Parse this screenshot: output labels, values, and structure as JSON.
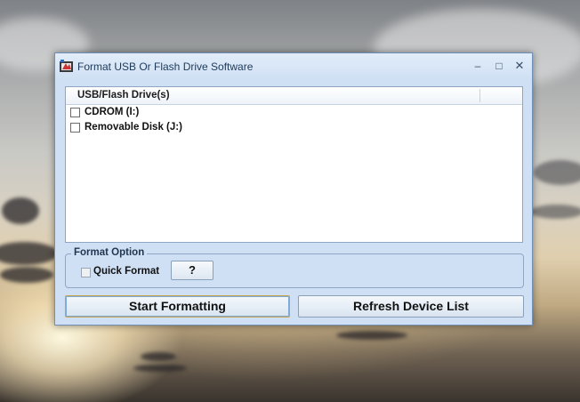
{
  "window": {
    "title": "Format USB Or Flash Drive Software",
    "controls": {
      "minimize": "–",
      "maximize": "□",
      "close": "✕"
    }
  },
  "drive_list": {
    "column_header": "USB/Flash Drive(s)",
    "items": [
      {
        "label": "CDROM (I:)",
        "checked": false
      },
      {
        "label": "Removable Disk (J:)",
        "checked": false
      }
    ]
  },
  "format_option": {
    "legend": "Format Option",
    "quick_format_label": "Quick Format",
    "quick_format_checked": false,
    "help_label": "?"
  },
  "actions": {
    "start_label": "Start Formatting",
    "refresh_label": "Refresh Device List"
  }
}
